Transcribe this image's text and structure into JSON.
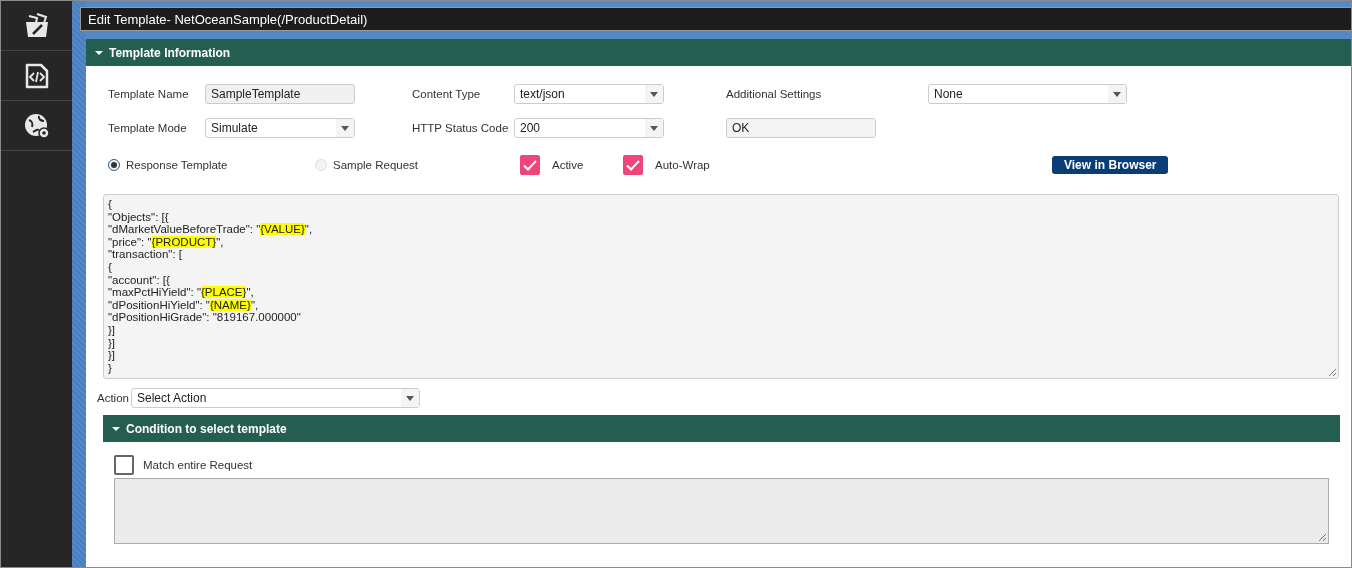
{
  "window": {
    "title": "Edit Template- NetOceanSample(/ProductDetail)"
  },
  "template_information": {
    "title": "Template Information",
    "expanded": true,
    "fields": [
      {
        "label": "Template Name",
        "kind": "text",
        "value": "SampleTemplate"
      },
      {
        "label": "Content Type",
        "kind": "select",
        "value": "text/json"
      },
      {
        "label": "Additional Settings",
        "kind": "select",
        "value": "None"
      },
      {
        "label": "Template Mode",
        "kind": "select",
        "value": "Simulate"
      },
      {
        "label": "HTTP Status Code",
        "kind": "select",
        "value": "200"
      },
      {
        "kind": "readonly",
        "value": "OK"
      }
    ],
    "options": [
      {
        "kind": "radio",
        "label": "Response Template",
        "selected": true
      },
      {
        "kind": "radio",
        "label": "Sample Request",
        "selected": false
      },
      {
        "kind": "checkbox",
        "label": "Active",
        "checked": true
      },
      {
        "kind": "checkbox",
        "label": "Auto-Wrap",
        "checked": true
      }
    ],
    "view_button": "View in Browser",
    "editor": {
      "lines": [
        [
          {
            "text": "{"
          }
        ],
        [
          {
            "text": "\"Objects\": [{"
          }
        ],
        [
          {
            "text": "\"dMarketValueBeforeTrade\": \""
          },
          {
            "text": "{VALUE}",
            "highlighted": true
          },
          {
            "text": "\","
          }
        ],
        [
          {
            "text": "\"price\": \""
          },
          {
            "text": "{PRODUCT}",
            "highlighted": true
          },
          {
            "text": "\","
          }
        ],
        [
          {
            "text": "\"transaction\": ["
          }
        ],
        [
          {
            "text": "{"
          }
        ],
        [
          {
            "text": "\"account\": [{"
          }
        ],
        [
          {
            "text": "\"maxPctHiYield\": \""
          },
          {
            "text": "{PLACE}",
            "highlighted": true
          },
          {
            "text": "\","
          }
        ],
        [
          {
            "text": "\"dPositionHiYield\": \""
          },
          {
            "text": "{NAME}",
            "highlighted": true
          },
          {
            "text": "\","
          }
        ],
        [
          {
            "text": "\"dPositionHiGrade\": \"819167.000000\""
          }
        ],
        [
          {
            "text": "}]"
          }
        ],
        [
          {
            "text": "}]"
          }
        ],
        [
          {
            "text": "}]"
          }
        ],
        [
          {
            "text": "}"
          }
        ]
      ]
    },
    "action": {
      "label": "Action",
      "value": "Select Action"
    }
  },
  "condition": {
    "title": "Condition to select template",
    "expanded": true,
    "match_entire_request": {
      "label": "Match entire Request",
      "checked": false
    }
  }
}
